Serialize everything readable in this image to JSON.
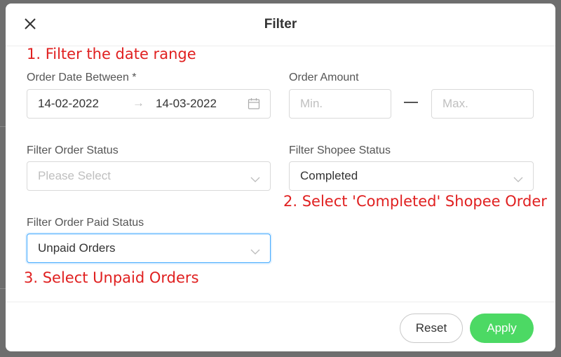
{
  "modal": {
    "title": "Filter"
  },
  "annotations": {
    "step1": "1. Filter the date range",
    "step2": "2. Select 'Completed' Shopee Order",
    "step3": "3. Select Unpaid Orders"
  },
  "order_date": {
    "label": "Order Date Between *",
    "start": "14-02-2022",
    "end": "14-03-2022",
    "separator": "→"
  },
  "order_amount": {
    "label": "Order Amount",
    "min_placeholder": "Min.",
    "max_placeholder": "Max."
  },
  "order_status": {
    "label": "Filter Order Status",
    "placeholder": "Please Select"
  },
  "shopee_status": {
    "label": "Filter Shopee Status",
    "value": "Completed"
  },
  "paid_status": {
    "label": "Filter Order Paid Status",
    "value": "Unpaid Orders"
  },
  "footer": {
    "reset_label": "Reset",
    "apply_label": "Apply"
  },
  "colors": {
    "annotation": "#e02020",
    "apply_button": "#4cd964",
    "focus_border": "#40a9ff",
    "backdrop": "#6e6e6e"
  },
  "icons": {
    "close": "close-icon",
    "calendar": "calendar-icon",
    "dropdown": "chevron-down-icon"
  }
}
